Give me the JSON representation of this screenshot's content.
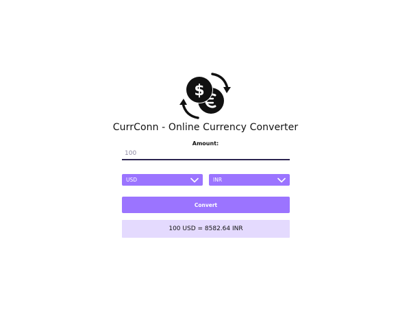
{
  "app": {
    "title": "CurrConn - Online Currency Converter",
    "logo_icon": "currency-exchange-coins-icon"
  },
  "form": {
    "amount_label": "Amount:",
    "amount_value": "100",
    "from_currency": "USD",
    "to_currency": "INR",
    "dropdown_icon": "chevron-down-icon",
    "convert_label": "Convert"
  },
  "result": {
    "text": "100 USD = 8582.64 INR"
  },
  "colors": {
    "accent": "#9b74ff",
    "result_bg": "#e4dafe",
    "input_underline": "#2b2350",
    "text": "#111111"
  }
}
